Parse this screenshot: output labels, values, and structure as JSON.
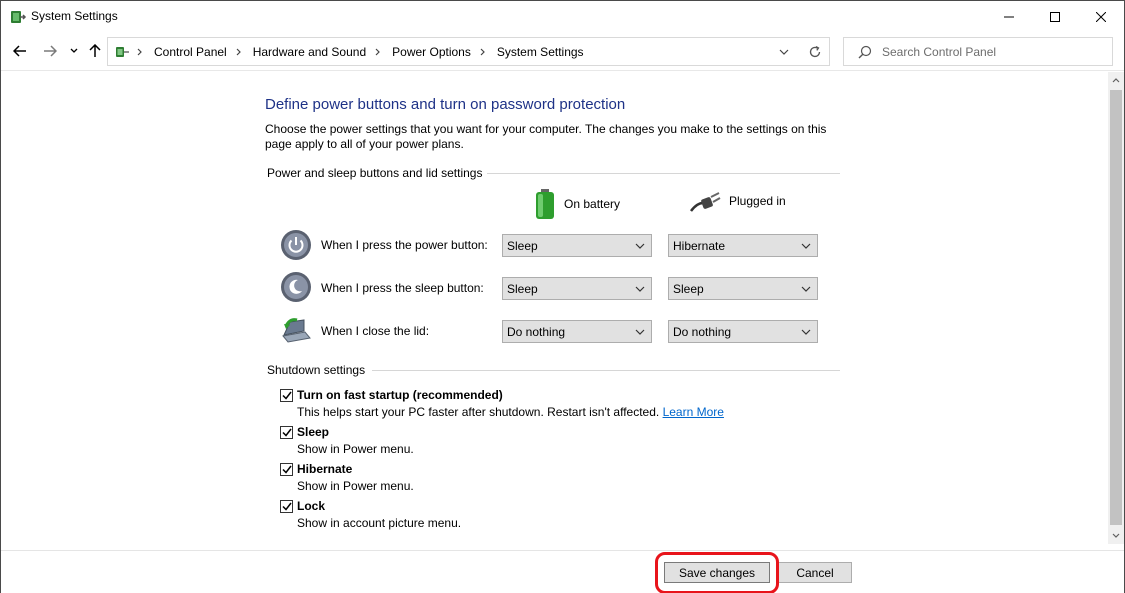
{
  "window": {
    "title": "System Settings"
  },
  "address": {
    "breadcrumbs": [
      "Control Panel",
      "Hardware and Sound",
      "Power Options",
      "System Settings"
    ]
  },
  "search": {
    "placeholder": "Search Control Panel"
  },
  "page": {
    "heading": "Define power buttons and turn on password protection",
    "description": "Choose the power settings that you want for your computer. The changes you make to the settings on this page apply to all of your power plans."
  },
  "power_section": {
    "title": "Power and sleep buttons and lid settings",
    "col_battery": "On battery",
    "col_plugged": "Plugged in",
    "rows": [
      {
        "label": "When I press the power button:",
        "battery": "Sleep",
        "plugged": "Hibernate",
        "icon": "power-button-icon"
      },
      {
        "label": "When I press the sleep button:",
        "battery": "Sleep",
        "plugged": "Sleep",
        "icon": "sleep-button-icon"
      },
      {
        "label": "When I close the lid:",
        "battery": "Do nothing",
        "plugged": "Do nothing",
        "icon": "laptop-lid-icon"
      }
    ]
  },
  "shutdown_section": {
    "title": "Shutdown settings",
    "items": [
      {
        "label": "Turn on fast startup (recommended)",
        "desc": "This helps start your PC faster after shutdown. Restart isn't affected.",
        "link": "Learn More",
        "checked": true
      },
      {
        "label": "Sleep",
        "desc": "Show in Power menu.",
        "checked": true
      },
      {
        "label": "Hibernate",
        "desc": "Show in Power menu.",
        "checked": true
      },
      {
        "label": "Lock",
        "desc": "Show in account picture menu.",
        "checked": true
      }
    ]
  },
  "footer": {
    "save_label": "Save changes",
    "cancel_label": "Cancel"
  },
  "colors": {
    "heading": "#1e3287",
    "link": "#0066cc",
    "highlight": "#e8141b"
  }
}
